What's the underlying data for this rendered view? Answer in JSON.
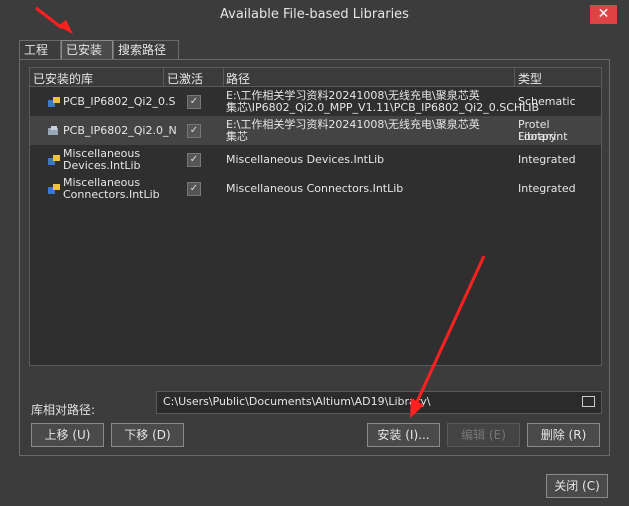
{
  "window": {
    "title": "Available File-based Libraries",
    "close_glyph": "✕"
  },
  "tabs": [
    {
      "label": "工程"
    },
    {
      "label": "已安装"
    },
    {
      "label": "搜索路径"
    }
  ],
  "columns": {
    "library": "已安装的库",
    "active": "已激活",
    "path": "路径",
    "type": "类型"
  },
  "rows": [
    {
      "name": "PCB_IP6802_Qi2_0.S",
      "active": "✓",
      "path_line1": "E:\\工作相关学习资料20241008\\无线充电\\聚泉芯英",
      "path_line2": "集芯\\IP6802_Qi2.0_MPP_V1.11\\PCB_IP6802_Qi2_0.SCHLIB",
      "type_line1": "Schematic",
      "type_line2": ""
    },
    {
      "name": "PCB_IP6802_Qi2.0_N",
      "active": "✓",
      "path_line1": "E:\\工作相关学习资料20241008\\无线充电\\聚泉芯英",
      "path_line2": "集芯",
      "type_line1": "Protel Footprint",
      "type_line2": "Library"
    },
    {
      "name_line1": "Miscellaneous",
      "name_line2": "Devices.IntLib",
      "active": "✓",
      "path_line1": "Miscellaneous Devices.IntLib",
      "type_line1": "Integrated"
    },
    {
      "name_line1": "Miscellaneous",
      "name_line2": "Connectors.IntLib",
      "active": "✓",
      "path_line1": "Miscellaneous Connectors.IntLib",
      "type_line1": "Integrated"
    }
  ],
  "relative_path": {
    "label": "库相对路径:",
    "value": "C:\\Users\\Public\\Documents\\Altium\\AD19\\Library\\"
  },
  "buttons": {
    "move_up": "上移 (U)",
    "move_down": "下移 (D)",
    "install": "安装 (I)...",
    "edit": "编辑 (E)",
    "remove": "删除 (R)",
    "close": "关闭 (C)"
  },
  "colors": {
    "accent": "#ff2020",
    "background": "#3c3c3c"
  }
}
